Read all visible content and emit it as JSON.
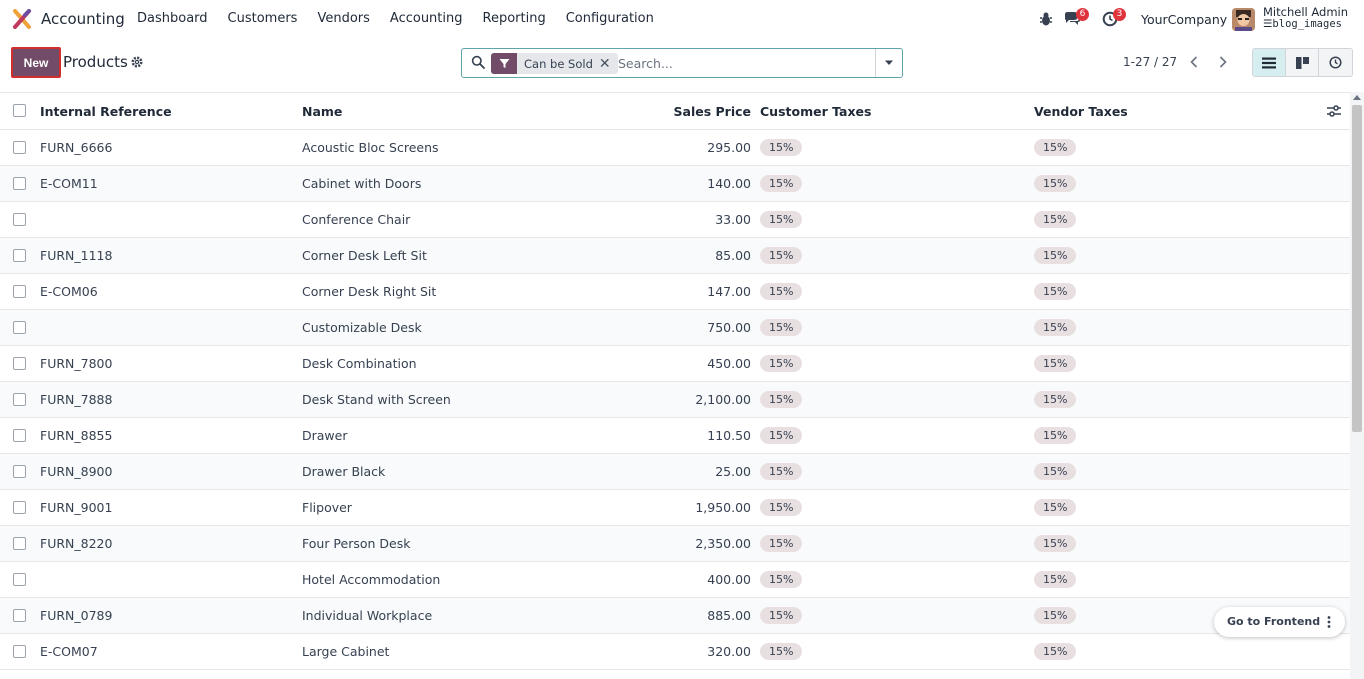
{
  "app": {
    "name": "Accounting",
    "menu": [
      "Dashboard",
      "Customers",
      "Vendors",
      "Accounting",
      "Reporting",
      "Configuration"
    ]
  },
  "systray": {
    "chat_count": "6",
    "activity_count": "3",
    "company": "YourCompany",
    "user_name": "Mitchell Admin",
    "database": "blog_images"
  },
  "control": {
    "new_label": "New",
    "title": "Products",
    "facet_label": "Can be Sold",
    "search_placeholder": "Search...",
    "pager": "1-27 / 27"
  },
  "table": {
    "headers": {
      "ref": "Internal Reference",
      "name": "Name",
      "price": "Sales Price",
      "customer_taxes": "Customer Taxes",
      "vendor_taxes": "Vendor Taxes"
    },
    "rows": [
      {
        "ref": "FURN_6666",
        "name": "Acoustic Bloc Screens",
        "price": "295.00",
        "ctax": "15%",
        "vtax": "15%"
      },
      {
        "ref": "E-COM11",
        "name": "Cabinet with Doors",
        "price": "140.00",
        "ctax": "15%",
        "vtax": "15%"
      },
      {
        "ref": "",
        "name": "Conference Chair",
        "price": "33.00",
        "ctax": "15%",
        "vtax": "15%"
      },
      {
        "ref": "FURN_1118",
        "name": "Corner Desk Left Sit",
        "price": "85.00",
        "ctax": "15%",
        "vtax": "15%"
      },
      {
        "ref": "E-COM06",
        "name": "Corner Desk Right Sit",
        "price": "147.00",
        "ctax": "15%",
        "vtax": "15%"
      },
      {
        "ref": "",
        "name": "Customizable Desk",
        "price": "750.00",
        "ctax": "15%",
        "vtax": "15%"
      },
      {
        "ref": "FURN_7800",
        "name": "Desk Combination",
        "price": "450.00",
        "ctax": "15%",
        "vtax": "15%"
      },
      {
        "ref": "FURN_7888",
        "name": "Desk Stand with Screen",
        "price": "2,100.00",
        "ctax": "15%",
        "vtax": "15%"
      },
      {
        "ref": "FURN_8855",
        "name": "Drawer",
        "price": "110.50",
        "ctax": "15%",
        "vtax": "15%"
      },
      {
        "ref": "FURN_8900",
        "name": "Drawer Black",
        "price": "25.00",
        "ctax": "15%",
        "vtax": "15%"
      },
      {
        "ref": "FURN_9001",
        "name": "Flipover",
        "price": "1,950.00",
        "ctax": "15%",
        "vtax": "15%"
      },
      {
        "ref": "FURN_8220",
        "name": "Four Person Desk",
        "price": "2,350.00",
        "ctax": "15%",
        "vtax": "15%"
      },
      {
        "ref": "",
        "name": "Hotel Accommodation",
        "price": "400.00",
        "ctax": "15%",
        "vtax": "15%"
      },
      {
        "ref": "FURN_0789",
        "name": "Individual Workplace",
        "price": "885.00",
        "ctax": "15%",
        "vtax": "15%"
      },
      {
        "ref": "E-COM07",
        "name": "Large Cabinet",
        "price": "320.00",
        "ctax": "15%",
        "vtax": "15%"
      }
    ]
  },
  "floating": {
    "frontend_label": "Go to Frontend"
  },
  "colors": {
    "brand": "#714b67",
    "accent": "#5fa4a9",
    "badge": "#e0343d"
  }
}
